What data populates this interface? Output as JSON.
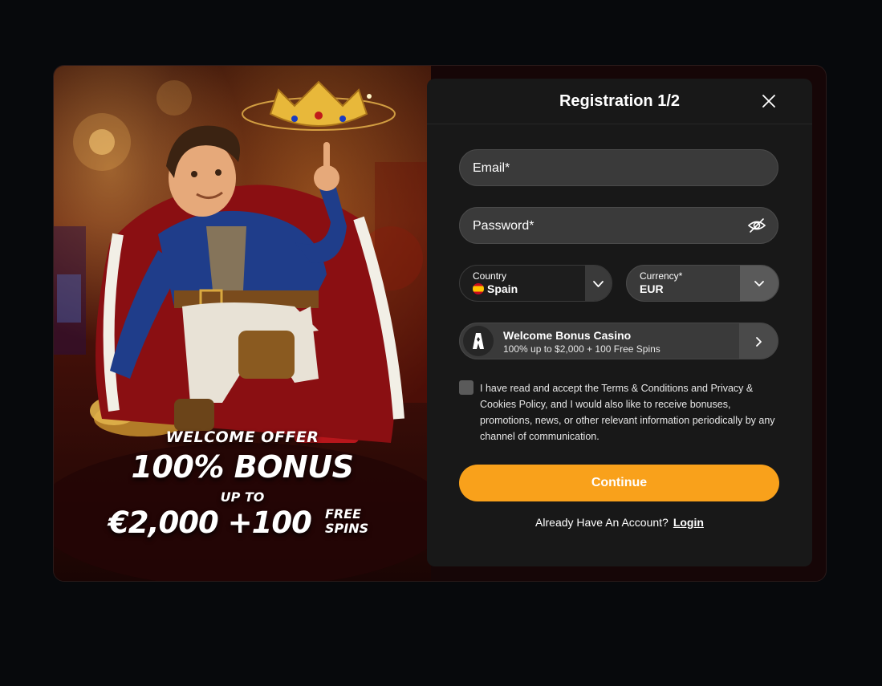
{
  "modal": {
    "title": "Registration 1/2"
  },
  "promo": {
    "welcome": "WELCOME OFFER",
    "bonus": "100% BONUS",
    "up_to": "UP TO",
    "amount": "€2,000 +100",
    "free_line1": "FREE",
    "free_line2": "SPINS"
  },
  "form": {
    "email_label": "Email*",
    "password_label": "Password*",
    "country": {
      "label": "Country",
      "value": "Spain"
    },
    "currency": {
      "label": "Currency*",
      "value": "EUR"
    },
    "bonus": {
      "title": "Welcome Bonus Casino",
      "subtitle": "100% up to $2,000 + 100 Free Spins"
    },
    "consent_text": "I have read and accept the Terms & Conditions and Privacy & Cookies Policy, and I would also like to receive bonuses, promotions, news, or other relevant information periodically by any channel of communication.",
    "continue_label": "Continue",
    "account_prompt": "Already Have An Account?",
    "login_label": "Login"
  },
  "colors": {
    "accent": "#f9a11b",
    "panel": "#181818",
    "field": "#3a3a3a",
    "background": "#07090c"
  },
  "icons": {
    "close": "close-icon",
    "eye": "eye-hidden-icon",
    "chevron": "chevron-down-icon",
    "arrow": "chevron-right-icon",
    "bonus_logo": "brand-logo-icon"
  }
}
